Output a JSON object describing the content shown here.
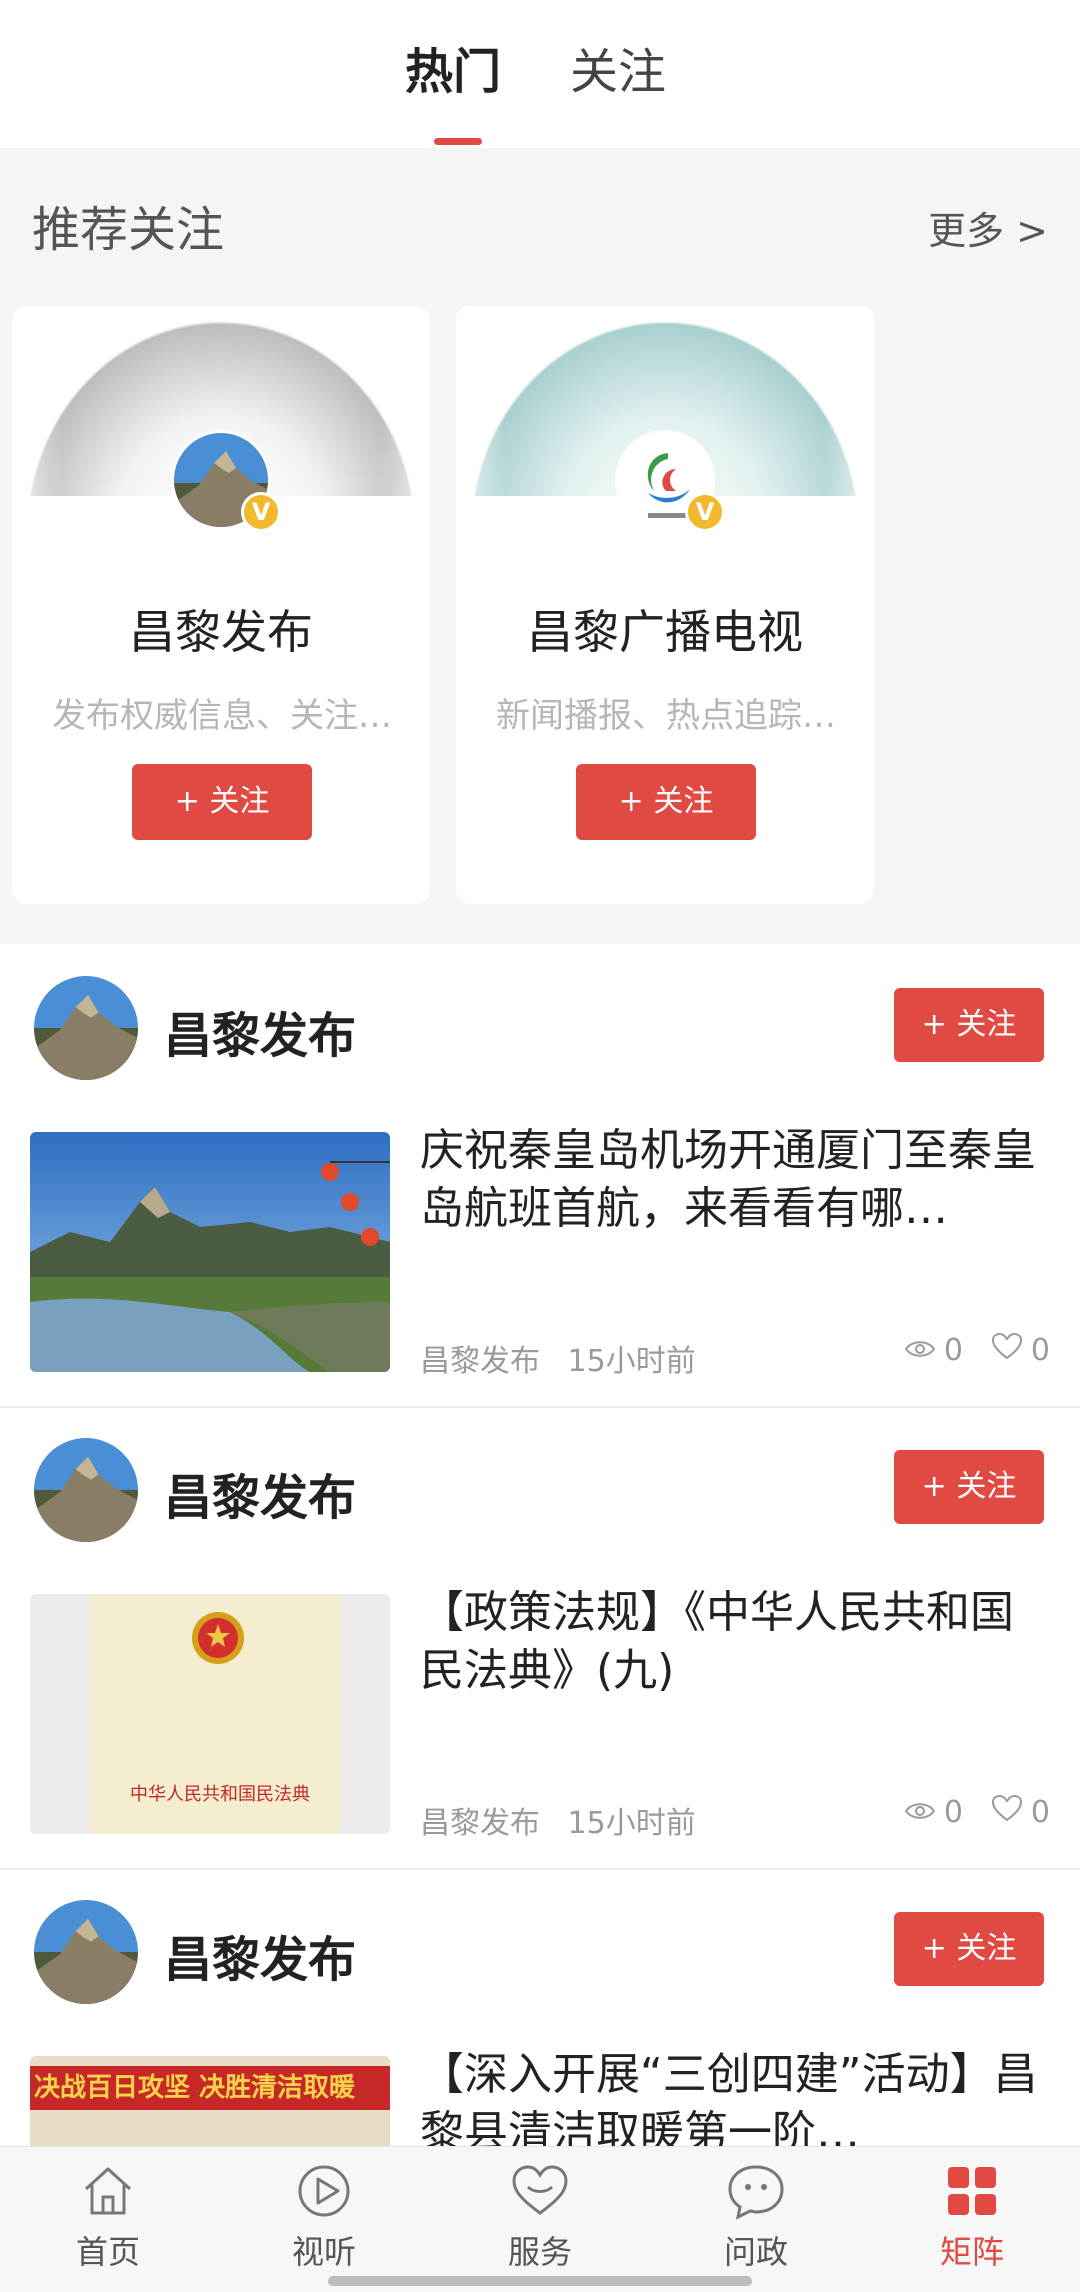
{
  "top_tabs": {
    "hot": "热门",
    "follow": "关注"
  },
  "recommend": {
    "title": "推荐关注",
    "more": "更多 >",
    "cards": [
      {
        "name": "昌黎发布",
        "desc": "发布权威信息、关注…",
        "follow_label": "+ 关注",
        "badge": "V"
      },
      {
        "name": "昌黎广播电视",
        "desc": "新闻播报、热点追踪…",
        "follow_label": "+ 关注",
        "badge": "V"
      }
    ]
  },
  "feed": [
    {
      "account": "昌黎发布",
      "follow_label": "+ 关注",
      "title": "庆祝秦皇岛机场开通厦门至秦皇岛航班首航，来看看有哪…",
      "source": "昌黎发布",
      "time": "15小时前",
      "views": "0",
      "likes": "0"
    },
    {
      "account": "昌黎发布",
      "follow_label": "+ 关注",
      "title": "【政策法规】《中华人民共和国民法典》(九)",
      "source": "昌黎发布",
      "time": "15小时前",
      "views": "0",
      "likes": "0",
      "thumb_text": "中华人民共和国民法典"
    },
    {
      "account": "昌黎发布",
      "follow_label": "+ 关注",
      "title": "【深入开展“三创四建”活动】昌黎县清洁取暖第一阶…",
      "thumb_text": "决战百日攻坚 决胜清洁取暖"
    }
  ],
  "bottom_nav": [
    {
      "label": "首页",
      "icon": "home-icon"
    },
    {
      "label": "视听",
      "icon": "play-icon"
    },
    {
      "label": "服务",
      "icon": "heart-service-icon"
    },
    {
      "label": "问政",
      "icon": "chat-icon"
    },
    {
      "label": "矩阵",
      "icon": "grid-icon",
      "active": true
    }
  ],
  "colors": {
    "accent": "#e04a43",
    "badge": "#f2b92d"
  }
}
